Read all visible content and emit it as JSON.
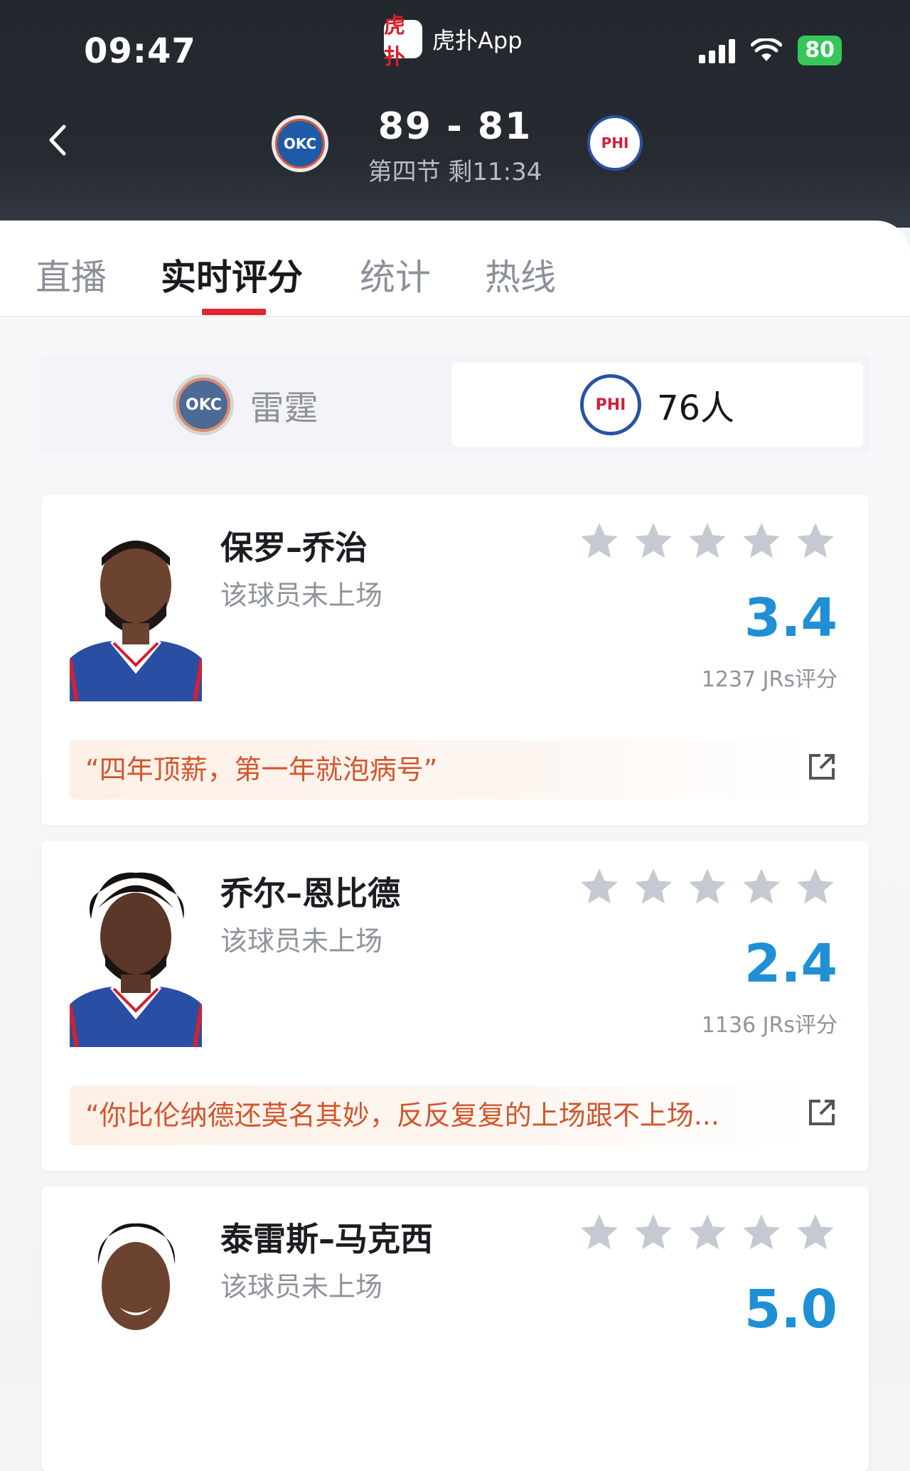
{
  "status_bar": {
    "time": "09:47",
    "battery": "80"
  },
  "app": {
    "logo_text": "虎扑",
    "name": "虎扑App"
  },
  "game": {
    "score": "89 - 81",
    "period": "第四节 剩11:34",
    "home_logo": "OKC",
    "away_logo": "PHI"
  },
  "tabs": [
    "直播",
    "实时评分",
    "统计",
    "热线"
  ],
  "active_tab": 1,
  "team_switch": {
    "left": {
      "name": "雷霆",
      "logo": "OKC"
    },
    "right": {
      "name": "76人",
      "logo": "PHI"
    },
    "selected": "right"
  },
  "players": [
    {
      "name": "保罗–乔治",
      "status": "该球员未上场",
      "rating": "3.4",
      "votes": "1237 JRs评分",
      "comment": "“四年顶薪，第一年就泡病号”"
    },
    {
      "name": "乔尔–恩比德",
      "status": "该球员未上场",
      "rating": "2.4",
      "votes": "1136 JRs评分",
      "comment": "“你比伦纳德还莫名其妙，反反复复的上场跟不上场..."
    },
    {
      "name": "泰雷斯–马克西",
      "status": "该球员未上场",
      "rating": "5.0"
    }
  ],
  "colors": {
    "accent": "#e0262f",
    "rating_blue": "#1f8fd6",
    "comment_orange": "#d2562d",
    "star_gray": "#c5c9d1"
  },
  "icons": [
    "back-chevron-icon",
    "signal-icon",
    "wifi-icon",
    "star-icon",
    "share-icon"
  ]
}
